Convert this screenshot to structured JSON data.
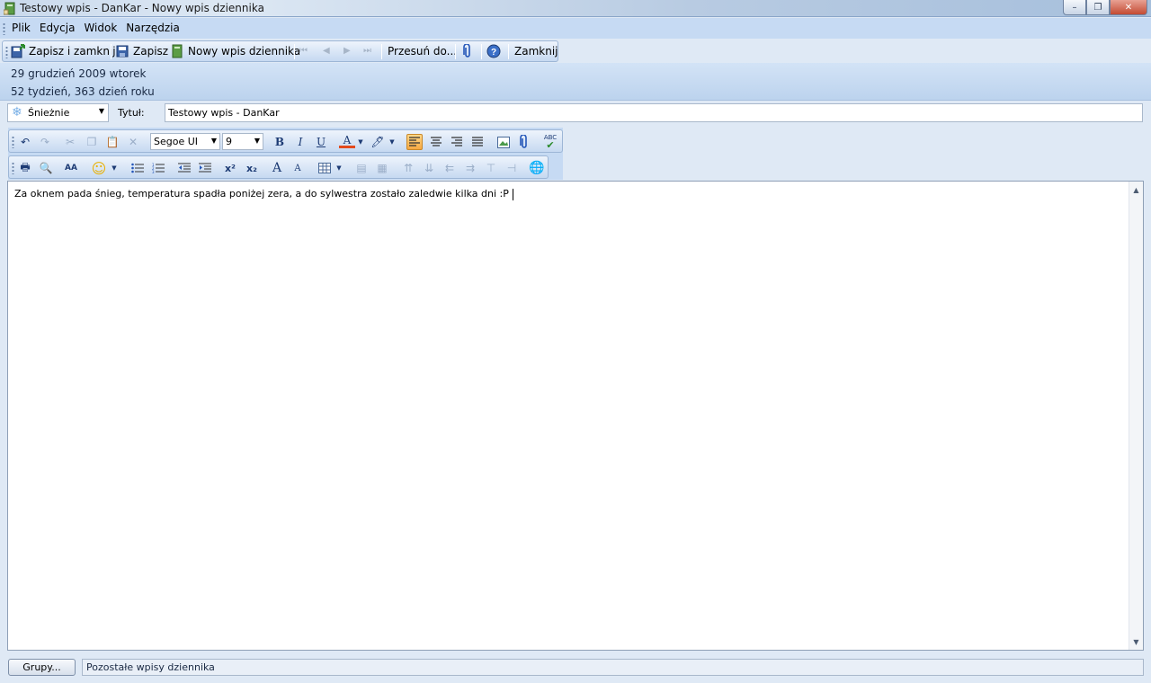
{
  "window": {
    "title": "Testowy wpis - DanKar - Nowy wpis dziennika",
    "minimize": "–",
    "restore": "❐",
    "close": "✕"
  },
  "menu": {
    "items": [
      "Plik",
      "Edycja",
      "Widok",
      "Narzędzia"
    ]
  },
  "toolbar": {
    "save_close": "Zapisz i zamknij",
    "save": "Zapisz",
    "new_entry": "Nowy wpis dziennika",
    "move_to": "Przesuń do...",
    "close": "Zamknij",
    "help": "?"
  },
  "date_info": {
    "date_line": "29 grudzień 2009 wtorek",
    "week_line": "52 tydzień,  363 dzień roku"
  },
  "entry": {
    "mood": "Śnieżnie",
    "title_label": "Tytuł:",
    "title_value": "Testowy wpis - DanKar",
    "body": "Za oknem pada śnieg, temperatura spadła poniżej zera, a do sylwestra zostało zaledwie kilka dni :P"
  },
  "format": {
    "font_name": "Segoe UI",
    "font_size": "9",
    "bold": "B",
    "italic": "I",
    "underline": "U",
    "font_color": "A",
    "superscript": "x²",
    "subscript": "x₂",
    "grow_font": "A",
    "shrink_font": "A",
    "spellcheck": "ABC",
    "find": "AA"
  },
  "footer": {
    "groups_button": "Grupy...",
    "other_entries": "Pozostałe wpisy dziennika"
  },
  "colors": {
    "accent": "#c6daf3",
    "toolbar_border": "#9db6d6",
    "font_color_swatch": "#e34a1c",
    "active_align": "#f6a843"
  },
  "icons": [
    "app-journal-icon",
    "save-close-icon",
    "save-icon",
    "new-entry-icon",
    "first-icon",
    "prev-icon",
    "next-icon",
    "last-icon",
    "attach-icon",
    "help-icon",
    "snowflake-icon",
    "undo-icon",
    "redo-icon",
    "cut-icon",
    "copy-icon",
    "paste-icon",
    "delete-icon",
    "highlight-icon",
    "align-left-icon",
    "align-center-icon",
    "align-right-icon",
    "justify-icon",
    "image-icon",
    "print-icon",
    "print-preview-icon",
    "find-icon",
    "emoticon-icon",
    "bullets-icon",
    "numbering-icon",
    "indent-decrease-icon",
    "indent-increase-icon",
    "table-icon",
    "web-link-icon"
  ]
}
